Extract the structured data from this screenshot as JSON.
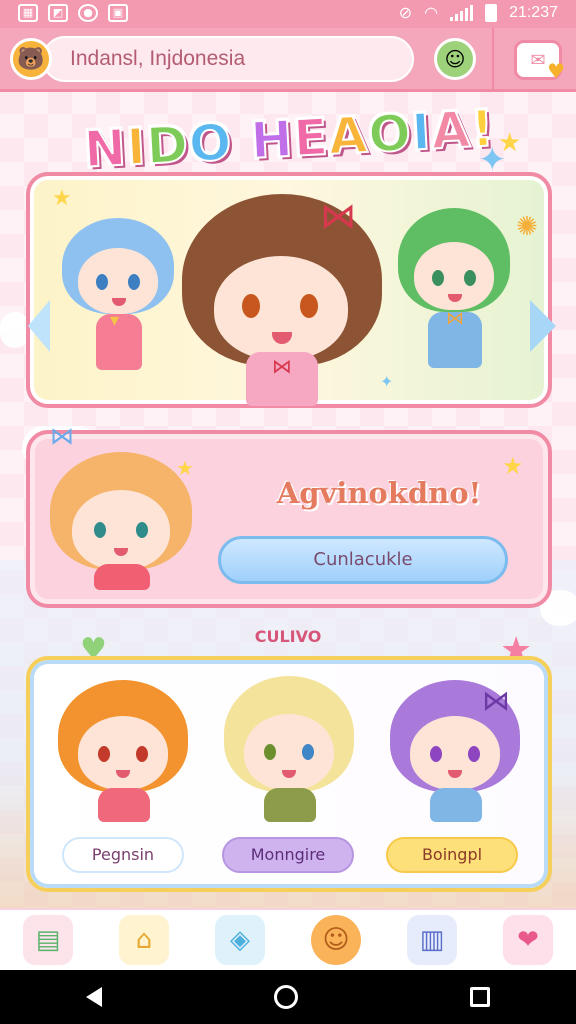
{
  "status_bar": {
    "time": "21:237",
    "left_icons": [
      "gallery-icon",
      "image-icon",
      "chat-icon",
      "sim-icon"
    ],
    "right_icons": [
      "mute-icon",
      "wifi-icon",
      "signal-icon",
      "battery-icon"
    ]
  },
  "header": {
    "search_value": "Indansl, Injdonesia",
    "avatar_left": "bear-avatar",
    "avatar_right": "boy-avatar",
    "message_button_icon": "mail-heart-icon"
  },
  "title": {
    "text": "NIDO HEAOIA!",
    "letter_colors": [
      "#f06aa7",
      "#f9b43a",
      "#7fcb5a",
      "#5bb7ef",
      "#c06fe8",
      "#f06aa7",
      "#f9b43a",
      "#7fcb5a",
      "#5bb7ef",
      "#f28aa6",
      "#ffcf3d",
      "#f06aa7"
    ]
  },
  "greeting_card": {
    "heading": "Agvinokdno!",
    "button_label": "Cunlacukle"
  },
  "characters_section": {
    "label": "CULIVO",
    "characters": [
      {
        "name": "Pegnsin",
        "hair": "#f3932f",
        "outfit": "#f0697b"
      },
      {
        "name": "Monngire",
        "hair": "#f4e39a",
        "outfit": "#8c9c4a"
      },
      {
        "name": "Boingpl",
        "hair": "#a97ad9",
        "outfit": "#7fb6e6"
      }
    ]
  },
  "bottom_nav": [
    {
      "icon": "stack-book-icon"
    },
    {
      "icon": "house-icon"
    },
    {
      "icon": "game-controller-icon"
    },
    {
      "icon": "smile-face-icon"
    },
    {
      "icon": "document-icon"
    },
    {
      "icon": "chat-bubble-icon"
    }
  ],
  "colors": {
    "accent": "#f08aa5",
    "button_blue": "#9fd0fb",
    "status_pink": "#f39ab1"
  }
}
